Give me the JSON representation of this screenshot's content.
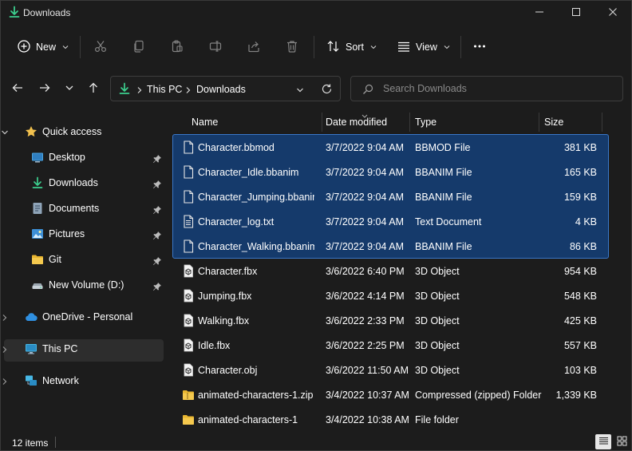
{
  "window": {
    "title": "Downloads",
    "icons": {
      "app": "download-icon",
      "minimize": "minimize-icon",
      "maximize": "maximize-icon",
      "close": "close-icon"
    }
  },
  "toolbar": {
    "new_label": "New",
    "sort_label": "Sort",
    "view_label": "View",
    "icons": [
      "plus-circle-icon",
      "cut-icon",
      "copy-icon",
      "paste-icon",
      "rename-icon",
      "share-icon",
      "delete-icon",
      "sort-icon",
      "view-icon",
      "more-icon"
    ]
  },
  "address": {
    "crumbs": [
      "This PC",
      "Downloads"
    ],
    "icons": {
      "location": "download-icon",
      "dropdown": "chevron-down-icon",
      "refresh": "refresh-icon"
    }
  },
  "search": {
    "placeholder": "Search Downloads",
    "icon": "search-icon"
  },
  "nav": {
    "icons": [
      "back-arrow-icon",
      "forward-arrow-icon",
      "recent-chevron-icon",
      "up-arrow-icon"
    ]
  },
  "sidebar": {
    "quick_access": "Quick access",
    "items": [
      {
        "label": "Desktop",
        "icon": "desktop-icon",
        "pinned": true
      },
      {
        "label": "Downloads",
        "icon": "download-icon",
        "pinned": true
      },
      {
        "label": "Documents",
        "icon": "documents-icon",
        "pinned": true
      },
      {
        "label": "Pictures",
        "icon": "pictures-icon",
        "pinned": true
      },
      {
        "label": "Git",
        "icon": "folder-icon",
        "pinned": true
      },
      {
        "label": "New Volume (D:)",
        "icon": "drive-icon",
        "pinned": true
      }
    ],
    "onedrive": "OneDrive - Personal",
    "this_pc": "This PC",
    "network": "Network"
  },
  "columns": {
    "name": "Name",
    "date": "Date modified",
    "type": "Type",
    "size": "Size"
  },
  "files": [
    {
      "name": "Character.bbmod",
      "date": "3/7/2022 9:04 AM",
      "type": "BBMOD File",
      "size": "381 KB",
      "icon": "file-icon",
      "selected": true
    },
    {
      "name": "Character_Idle.bbanim",
      "date": "3/7/2022 9:04 AM",
      "type": "BBANIM File",
      "size": "165 KB",
      "icon": "file-icon",
      "selected": true
    },
    {
      "name": "Character_Jumping.bbanim",
      "date": "3/7/2022 9:04 AM",
      "type": "BBANIM File",
      "size": "159 KB",
      "icon": "file-icon",
      "selected": true
    },
    {
      "name": "Character_log.txt",
      "date": "3/7/2022 9:04 AM",
      "type": "Text Document",
      "size": "4 KB",
      "icon": "text-file-icon",
      "selected": true
    },
    {
      "name": "Character_Walking.bbanim",
      "date": "3/7/2022 9:04 AM",
      "type": "BBANIM File",
      "size": "86 KB",
      "icon": "file-icon",
      "selected": true
    },
    {
      "name": "Character.fbx",
      "date": "3/6/2022 6:40 PM",
      "type": "3D Object",
      "size": "954 KB",
      "icon": "3d-object-icon",
      "selected": false
    },
    {
      "name": "Jumping.fbx",
      "date": "3/6/2022 4:14 PM",
      "type": "3D Object",
      "size": "548 KB",
      "icon": "3d-object-icon",
      "selected": false
    },
    {
      "name": "Walking.fbx",
      "date": "3/6/2022 2:33 PM",
      "type": "3D Object",
      "size": "425 KB",
      "icon": "3d-object-icon",
      "selected": false
    },
    {
      "name": "Idle.fbx",
      "date": "3/6/2022 2:25 PM",
      "type": "3D Object",
      "size": "557 KB",
      "icon": "3d-object-icon",
      "selected": false
    },
    {
      "name": "Character.obj",
      "date": "3/6/2022 11:50 AM",
      "type": "3D Object",
      "size": "103 KB",
      "icon": "3d-object-icon",
      "selected": false
    },
    {
      "name": "animated-characters-1.zip",
      "date": "3/4/2022 10:37 AM",
      "type": "Compressed (zipped) Folder",
      "size": "1,339 KB",
      "icon": "zip-folder-icon",
      "selected": false
    },
    {
      "name": "animated-characters-1",
      "date": "3/4/2022 10:38 AM",
      "type": "File folder",
      "size": "",
      "icon": "folder-icon",
      "selected": false
    }
  ],
  "status": {
    "item_count": "12 items",
    "view_icons": [
      "details-view-icon",
      "tiles-view-icon"
    ]
  },
  "colors": {
    "background": "#1c1c1c",
    "selection": "#153a6b",
    "selection_border": "#3a77c8",
    "accent_green": "#3ccf8e",
    "folder_yellow": "#f2c14e"
  }
}
